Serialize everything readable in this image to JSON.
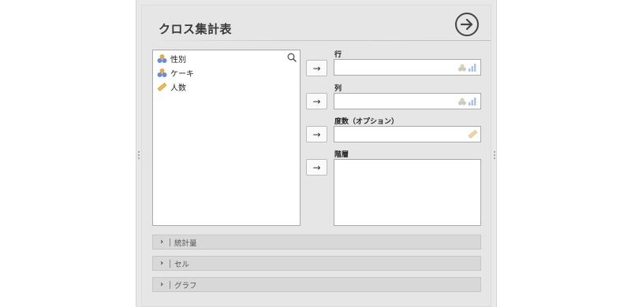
{
  "analysis": {
    "title": "クロス集計表",
    "run_icon": "arrow-circle-right-icon"
  },
  "variables": [
    {
      "label": "性別",
      "icon": "nominal-icon"
    },
    {
      "label": "ケーキ",
      "icon": "nominal-icon"
    },
    {
      "label": "人数",
      "icon": "continuous-ruler-icon"
    }
  ],
  "targets": {
    "rows": {
      "label": "行"
    },
    "columns": {
      "label": "列"
    },
    "counts": {
      "label": "度数（オプション）"
    },
    "layers": {
      "label": "階層"
    }
  },
  "sections": [
    {
      "label": "統計量"
    },
    {
      "label": "セル"
    },
    {
      "label": "グラフ"
    }
  ],
  "colors": {
    "nominal_blue": "#6a8fd0",
    "nominal_orange": "#e9a84a",
    "ruler": "#e9b960",
    "hint_gray": "#c9c9c9",
    "hint_blue": "#a9c4ea"
  }
}
